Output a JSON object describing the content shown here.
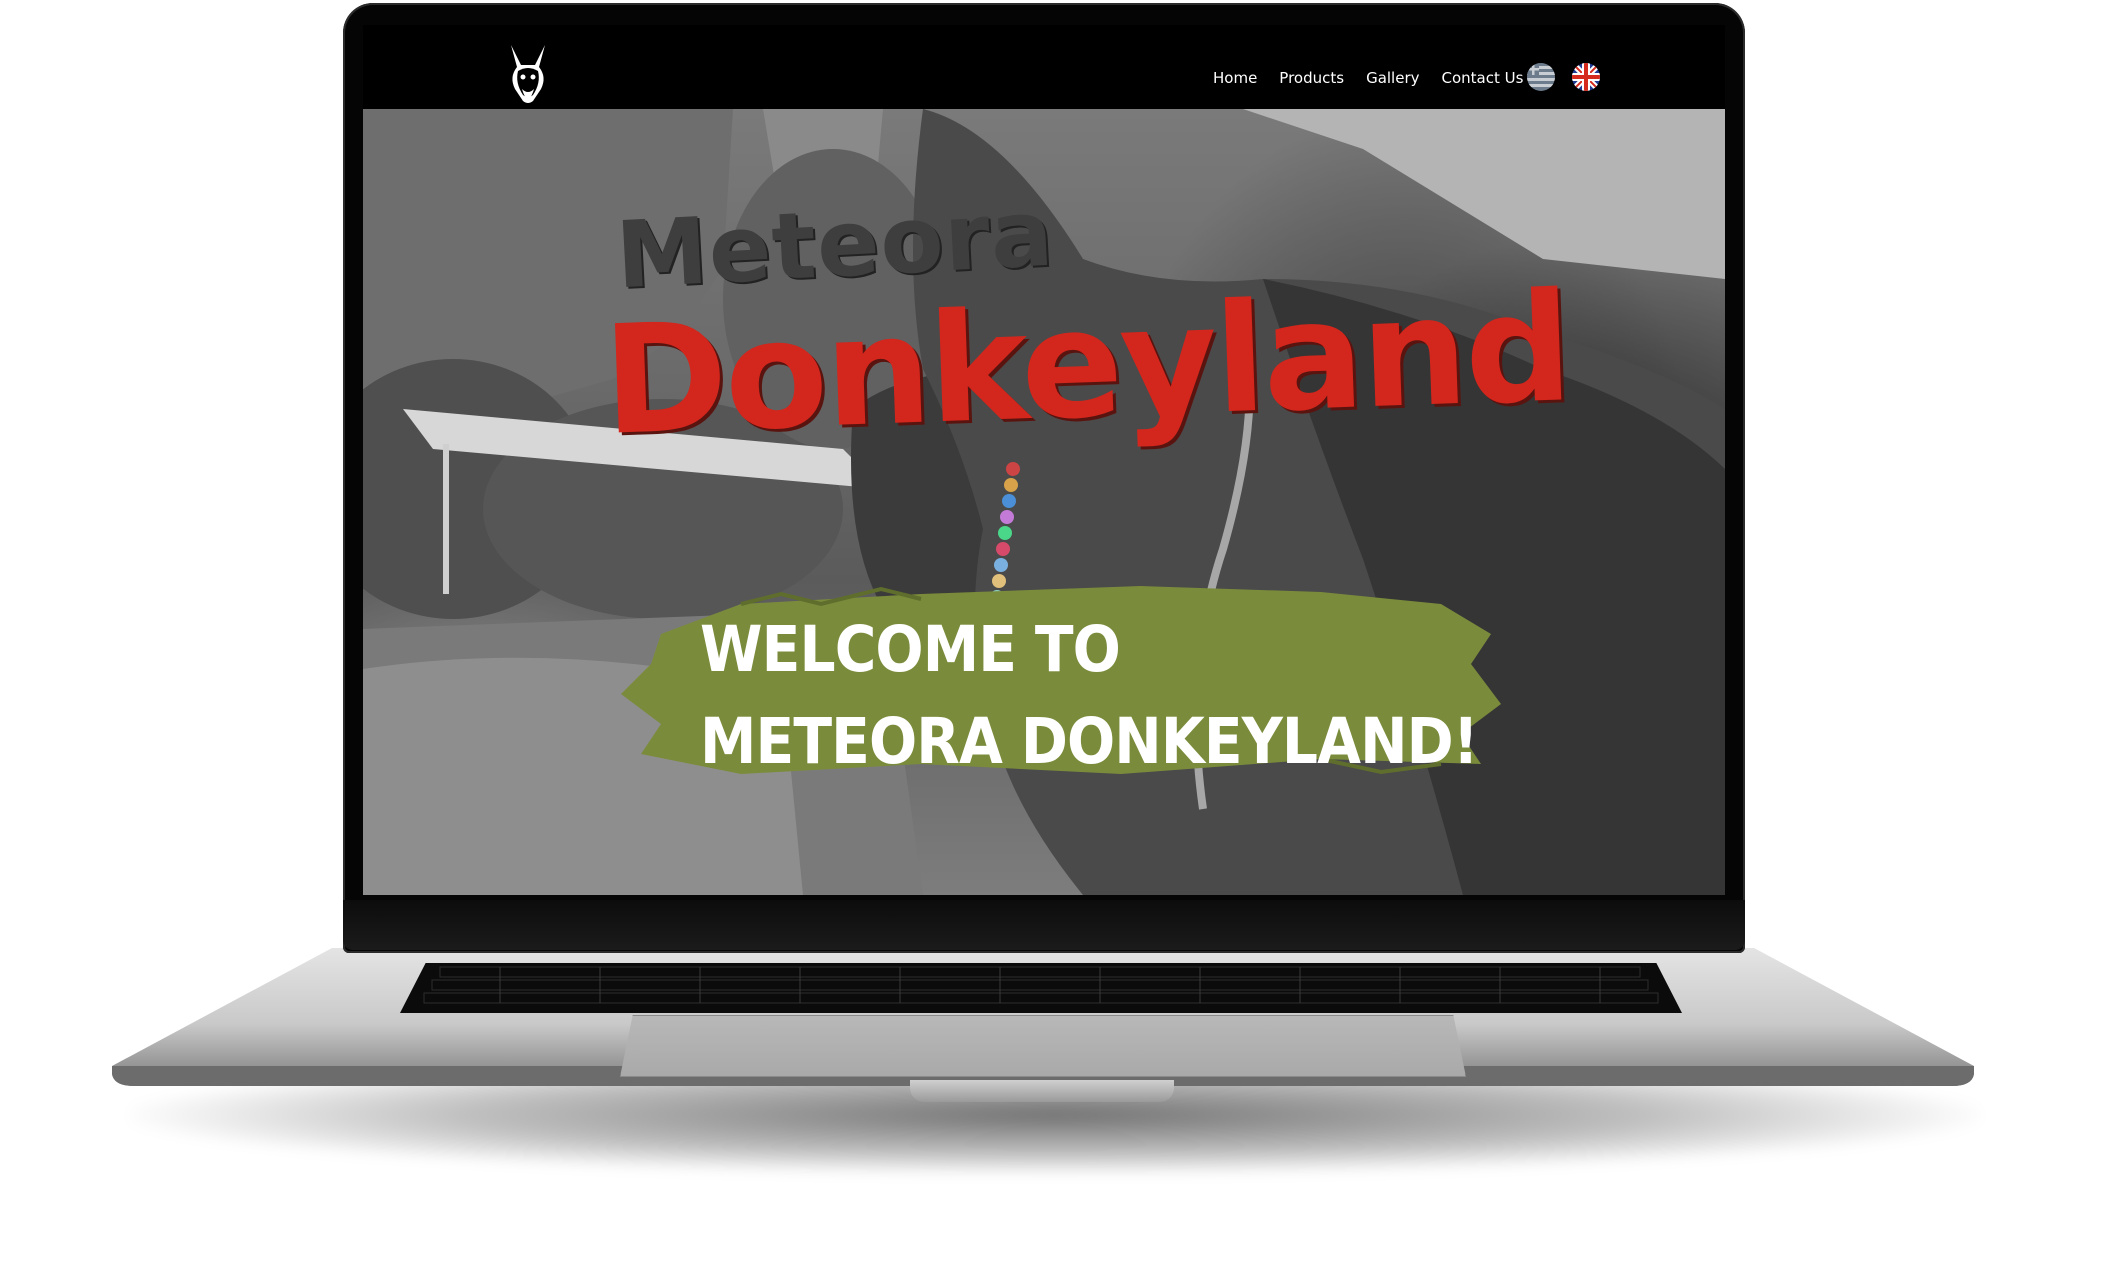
{
  "nav": {
    "links": [
      "Home",
      "Products",
      "Gallery",
      "Contact Us"
    ],
    "languages": [
      {
        "name": "greek-flag-icon"
      },
      {
        "name": "uk-flag-icon"
      }
    ]
  },
  "hero": {
    "logo_word_1": "Meteora",
    "logo_word_2": "Donkeyland",
    "welcome_line_1": "WELCOME TO",
    "welcome_line_2": "METEORA DONKEYLAND!"
  },
  "colors": {
    "brand_red": "#d3261c",
    "brush_green": "#7a8c3b",
    "nav_bg": "#000000"
  }
}
